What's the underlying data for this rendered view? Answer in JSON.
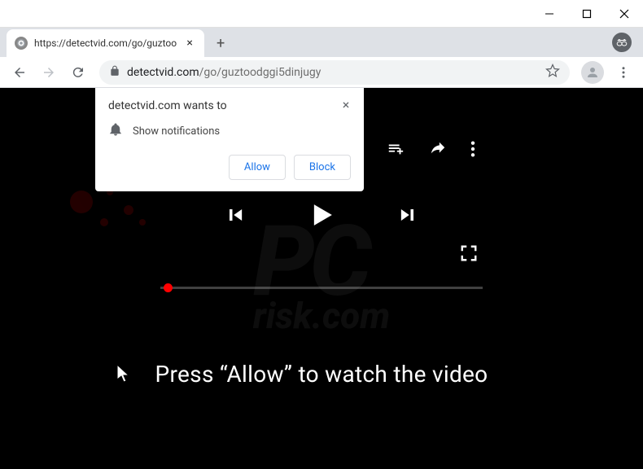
{
  "window": {
    "tab_title": "https://detectvid.com/go/guztoo",
    "url_host": "detectvid.com",
    "url_path": "/go/guztoodggi5dinjugy"
  },
  "notification": {
    "title": "detectvid.com wants to",
    "body": "Show notifications",
    "allow_label": "Allow",
    "block_label": "Block"
  },
  "page": {
    "instruction": "Press “Allow” to watch the video"
  },
  "watermark": {
    "brand": "PC",
    "domain": "risk.com"
  }
}
